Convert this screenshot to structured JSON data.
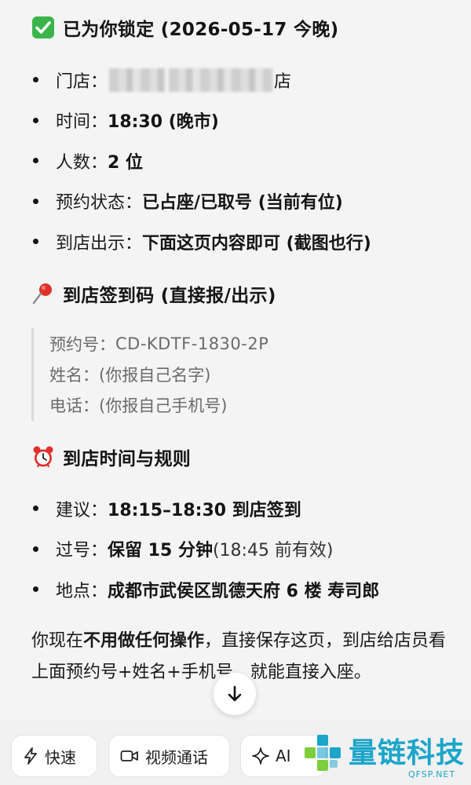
{
  "header": {
    "title": "已为你锁定 (2026-05-17 今晚)"
  },
  "details": [
    {
      "label": "门店：",
      "value": "",
      "suffix": "店",
      "redacted": true
    },
    {
      "label": "时间：",
      "value": "18:30 (晚市)"
    },
    {
      "label": "人数：",
      "value": "2 位"
    },
    {
      "label": "预约状态：",
      "value": "已占座/已取号 (当前有位)"
    },
    {
      "label": "到店出示：",
      "value": "下面这页内容即可 (截图也行)"
    }
  ],
  "checkin": {
    "title": "到店签到码 (直接报/出示)",
    "lines": [
      {
        "label": "预约号：",
        "value": "CD-KDTF-1830-2P"
      },
      {
        "label": "姓名：",
        "value": "(你报自己名字)"
      },
      {
        "label": "电话：",
        "value": "(你报自己手机号)"
      }
    ]
  },
  "rules": {
    "title": "到店时间与规则",
    "items": [
      {
        "label": "建议：",
        "value": "18:15–18:30 到店签到",
        "extra": ""
      },
      {
        "label": "过号：",
        "value": "保留 15 分钟",
        "extra": " (18:45 前有效)"
      },
      {
        "label": "地点：",
        "value": "成都市武侯区凯德天府 6 楼 寿司郎",
        "extra": ""
      }
    ]
  },
  "note": {
    "p1": "你现在",
    "bold": "不用做任何操作",
    "p2": "，直接保存这页，到店给店员看上面预约号+姓名+手机号，就能直接入座。"
  },
  "toolbar": {
    "buttons": [
      {
        "label": "快速",
        "icon": "lightning-icon"
      },
      {
        "label": "视频通话",
        "icon": "video-camera-icon"
      },
      {
        "label": "AI",
        "icon": "sparkle-icon"
      }
    ]
  },
  "watermark": {
    "text": "量链科技",
    "sub": "QFSP.NET"
  },
  "colors": {
    "text": "#141414",
    "muted": "#6b6b6b",
    "background": "#f4f4f4",
    "watermark": "#1aa5c9"
  }
}
